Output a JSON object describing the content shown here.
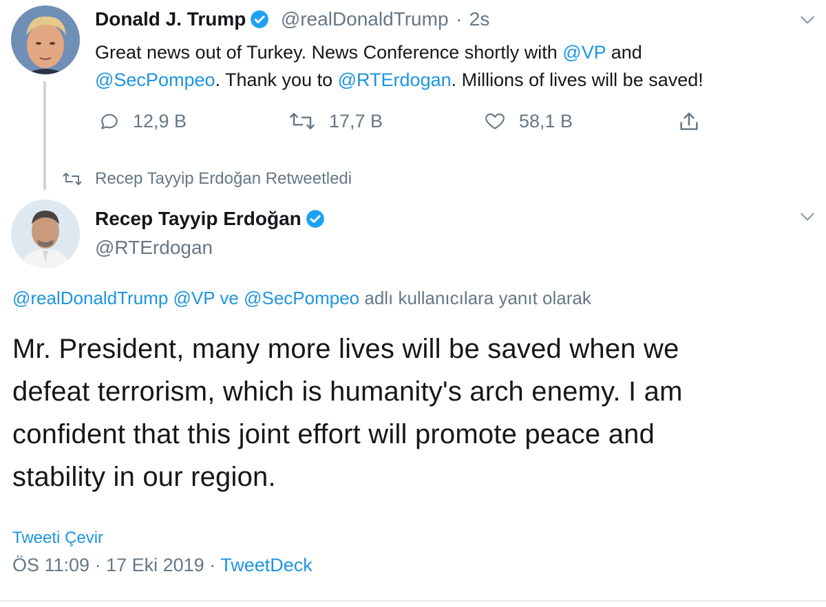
{
  "tweet1": {
    "name": "Donald J. Trump",
    "handle": "@realDonaldTrump",
    "sep": "·",
    "time": "2s",
    "text_segments": [
      {
        "t": "Great news out of Turkey. News Conference shortly with ",
        "link": false
      },
      {
        "t": "@VP",
        "link": true
      },
      {
        "t": " and",
        "link": false
      }
    ],
    "text_line2": [
      {
        "t": "@SecPompeo",
        "link": true
      },
      {
        "t": ". Thank you to ",
        "link": false
      },
      {
        "t": "@RTErdogan",
        "link": true
      },
      {
        "t": ". Millions of lives will be saved!",
        "link": false
      }
    ],
    "replies": "12,9 B",
    "retweets": "17,7 B",
    "likes": "58,1 B"
  },
  "retweet_notice": "Recep Tayyip Erdoğan Retweetledi",
  "tweet2": {
    "name": "Recep Tayyip Erdoğan",
    "handle": "@RTErdogan",
    "reply_to": {
      "u1": "@realDonaldTrump",
      "u2": "@VP",
      "ve": "ve",
      "u3": "@SecPompeo",
      "suffix": "adlı kullanıcılara yanıt olarak"
    },
    "lines": [
      "Mr. President, many more lives will be saved when we",
      "defeat terrorism, which is humanity's arch enemy. I am",
      "confident that this joint effort will promote peace and",
      "stability in our region."
    ],
    "translate": "Tweeti Çevir",
    "timestamp": "ÖS 11:09 · 17 Eki 2019 ·",
    "source": "TweetDeck"
  },
  "icons": {
    "accent": "#1da1f2",
    "link": "#1b95e0",
    "muted": "#657786"
  }
}
